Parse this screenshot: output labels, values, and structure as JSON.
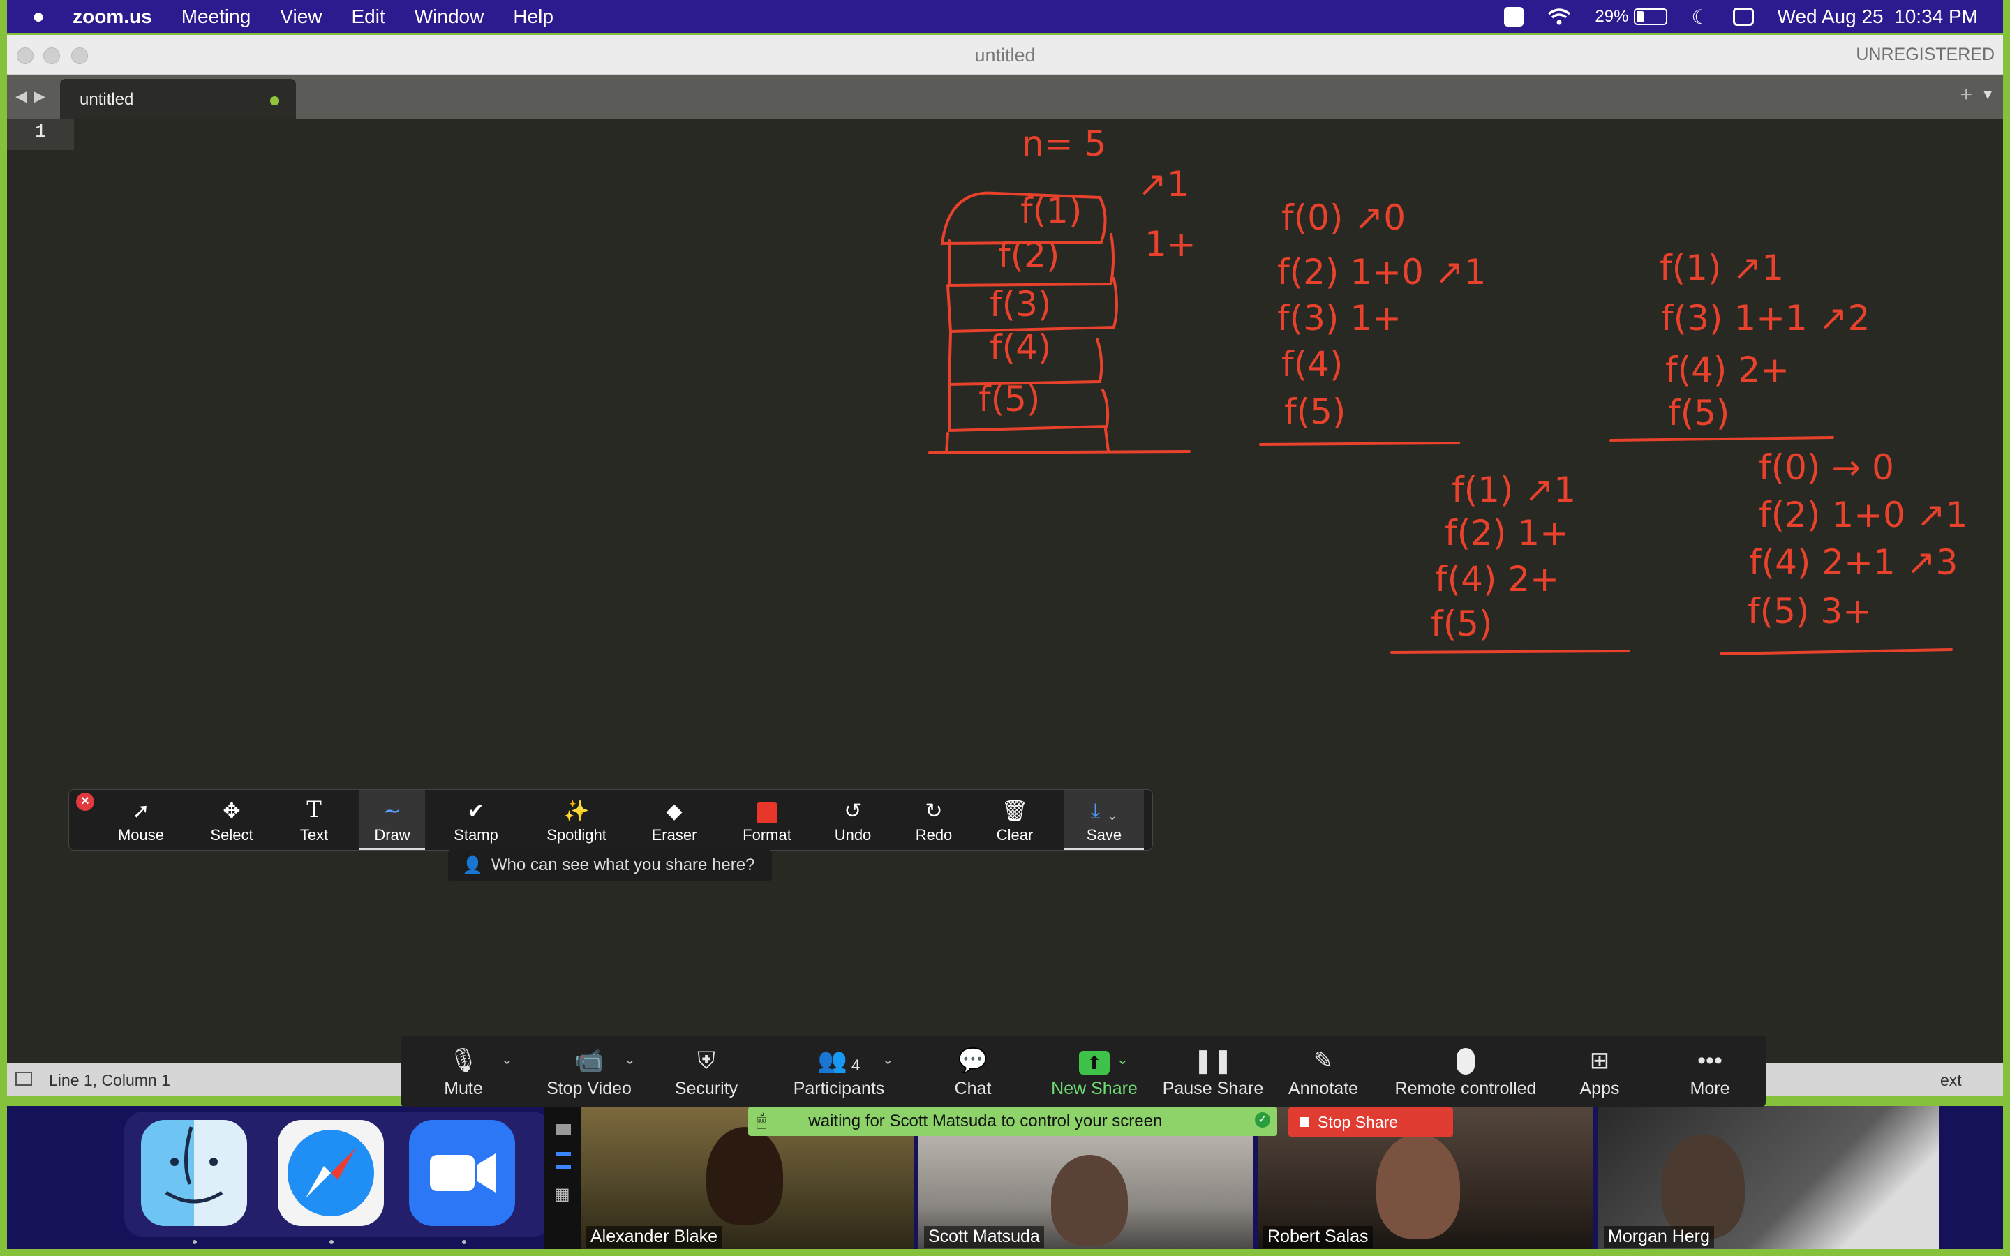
{
  "menubar": {
    "app_name": "zoom.us",
    "items": [
      "Meeting",
      "View",
      "Edit",
      "Window",
      "Help"
    ],
    "battery": "29%",
    "datetime": "Wed Aug 25  10:34 PM"
  },
  "editor": {
    "window_title": "untitled",
    "license_label": "UNREGISTERED",
    "tab_label": "untitled",
    "line_number": "1",
    "status_text": "Line 1, Column 1",
    "status_right_fragment": "ext"
  },
  "whiteboard": {
    "ink_color": "#e8412c",
    "stack": {
      "n_label": "n= 5",
      "frames": [
        "f(1)",
        "f(2)",
        "f(3)",
        "f(4)",
        "f(5)"
      ],
      "side_notes": [
        "↗1",
        "1+"
      ]
    },
    "trace1": [
      "f(0) ↗0",
      "f(2)  1+0 ↗1",
      "f(3)  1+",
      "f(4)",
      "f(5)"
    ],
    "trace2": [
      "f(1) ↗1",
      "f(3)  1+1 ↗2",
      "f(4)  2+",
      "f(5)"
    ],
    "trace3": [
      "f(1) ↗1",
      "f(2)  1+",
      "f(4)  2+",
      "f(5)"
    ],
    "trace4": [
      "f(0) → 0",
      "f(2)  1+0 ↗1",
      "f(4) 2+1 ↗3",
      "f(5)  3+"
    ]
  },
  "annotation_toolbar": {
    "tools": [
      {
        "label": "Mouse",
        "icon": "cursor-arrow-icon"
      },
      {
        "label": "Select",
        "icon": "move-arrows-icon"
      },
      {
        "label": "Text",
        "icon": "text-T-icon"
      },
      {
        "label": "Draw",
        "icon": "squiggle-icon"
      },
      {
        "label": "Stamp",
        "icon": "checkmark-icon"
      },
      {
        "label": "Spotlight",
        "icon": "magic-wand-icon"
      },
      {
        "label": "Eraser",
        "icon": "eraser-icon"
      },
      {
        "label": "Format",
        "icon": "red-square-icon"
      },
      {
        "label": "Undo",
        "icon": "undo-icon"
      },
      {
        "label": "Redo",
        "icon": "redo-icon"
      },
      {
        "label": "Clear",
        "icon": "trash-icon"
      },
      {
        "label": "Save",
        "icon": "download-tray-icon"
      }
    ],
    "active_tool": "Draw",
    "format_color": "#e8362b",
    "who_can_see": "Who can see what you share here?"
  },
  "meeting_controls": {
    "items": [
      {
        "label": "Mute",
        "icon": "microphone-icon"
      },
      {
        "label": "Stop Video",
        "icon": "video-camera-icon"
      },
      {
        "label": "Security",
        "icon": "shield-icon"
      },
      {
        "label": "Participants",
        "icon": "participants-icon",
        "count": "4"
      },
      {
        "label": "Chat",
        "icon": "chat-bubble-icon"
      },
      {
        "label": "New Share",
        "icon": "share-arrow-icon"
      },
      {
        "label": "Pause Share",
        "icon": "pause-icon"
      },
      {
        "label": "Annotate",
        "icon": "pencil-icon"
      },
      {
        "label": "Remote controlled",
        "icon": "mouse-icon"
      },
      {
        "label": "Apps",
        "icon": "apps-icon"
      },
      {
        "label": "More",
        "icon": "ellipsis-icon"
      }
    ],
    "share_color": "#3fc24a",
    "control_banner": "waiting for Scott Matsuda to control your screen",
    "stop_share": "Stop Share"
  },
  "participants": [
    {
      "name": "Alexander Blake"
    },
    {
      "name": "Scott Matsuda"
    },
    {
      "name": "Robert Salas"
    },
    {
      "name": "Morgan Herg"
    }
  ],
  "dock": [
    "Finder",
    "Safari",
    "Zoom"
  ]
}
